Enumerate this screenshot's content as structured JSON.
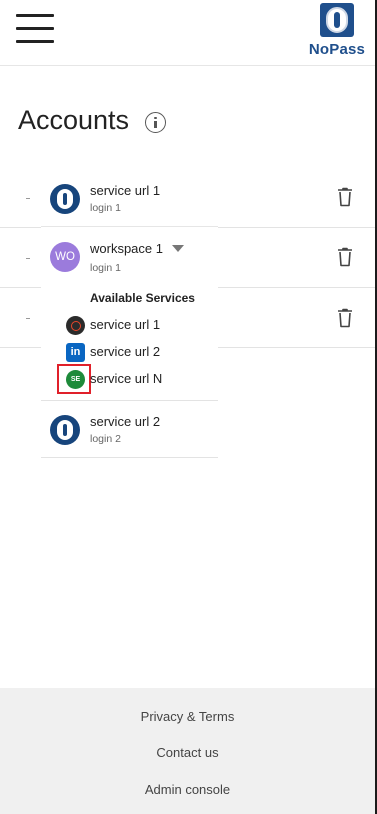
{
  "brand": {
    "name": "NoPass"
  },
  "page": {
    "title": "Accounts"
  },
  "dropdown": {
    "accounts": [
      {
        "title": "service url 1",
        "sub": "login 1"
      },
      {
        "title": "workspace 1",
        "sub": "login 1",
        "avatar_text": "WO"
      },
      {
        "title": "service url 2",
        "sub": "login 2"
      }
    ],
    "available_services_heading": "Available Services",
    "services": [
      {
        "label": "service url 1",
        "icon": "dark-service-icon"
      },
      {
        "label": "service url 2",
        "icon": "linkedin-icon",
        "icon_text": "in"
      },
      {
        "label": "service url N",
        "icon": "se-service-icon",
        "icon_text": "SE"
      }
    ]
  },
  "footer": {
    "privacy": "Privacy & Terms",
    "contact": "Contact us",
    "admin": "Admin console"
  },
  "colors": {
    "brand_blue": "#1f4f8c",
    "avatar_purple": "#9b7bdc",
    "highlight_red": "#e0202a",
    "footer_bg": "#f0f0f0"
  }
}
